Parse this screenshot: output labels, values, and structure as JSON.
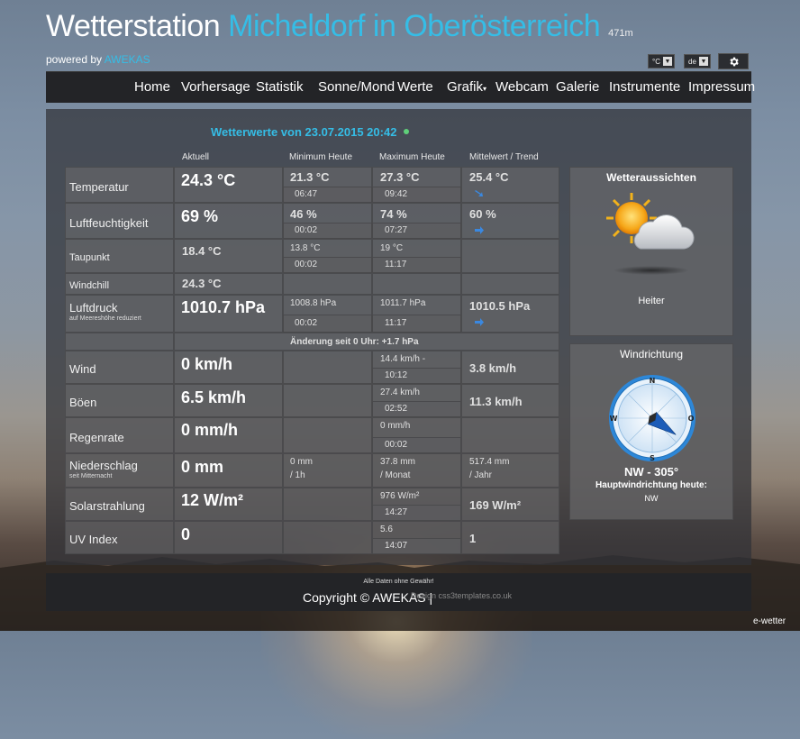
{
  "header": {
    "title_main": "Wetterstation",
    "title_location": "Micheldorf in Oberösterreich",
    "altitude": "471m",
    "powered_prefix": "powered by",
    "powered_link": "AWEKAS",
    "unit_select": "°C",
    "lang_select": "de"
  },
  "nav": [
    "Home",
    "Vorhersage",
    "Statistik",
    "Sonne/Mond",
    "Werte",
    "Grafik",
    "Webcam",
    "Galerie",
    "Instrumente",
    "Impressum"
  ],
  "weather": {
    "heading": "Wetterwerte von 23.07.2015 20:42",
    "columns": [
      "Aktuell",
      "Minimum Heute",
      "Maximum Heute",
      "Mittelwert / Trend"
    ],
    "rows": {
      "temperatur": {
        "label": "Temperatur",
        "current": "24.3 °C",
        "min": "21.3 °C",
        "min_time": "06:47",
        "max": "27.3 °C",
        "max_time": "09:42",
        "avg": "25.4 °C"
      },
      "feuchte": {
        "label": "Luftfeuchtigkeit",
        "current": "69 %",
        "min": "46 %",
        "min_time": "00:02",
        "max": "74 %",
        "max_time": "07:27",
        "avg": "60 %"
      },
      "taupunkt": {
        "label": "Taupunkt",
        "current": "18.4 °C",
        "min": "13.8 °C",
        "min_time": "00:02",
        "max": "19 °C",
        "max_time": "11:17"
      },
      "windchill": {
        "label": "Windchill",
        "current": "24.3 °C"
      },
      "luftdruck": {
        "label": "Luftdruck",
        "sublabel": "auf Meereshöhe reduziert",
        "current": "1010.7 hPa",
        "min": "1008.8 hPa",
        "min_time": "00:02",
        "max": "1011.7 hPa",
        "max_time": "11:17",
        "avg": "1010.5 hPa",
        "change": "Änderung seit 0 Uhr: +1.7 hPa"
      },
      "wind": {
        "label": "Wind",
        "current": "0 km/h",
        "max": "14.4 km/h -",
        "max_time": "10:12",
        "avg": "3.8 km/h"
      },
      "boeen": {
        "label": "Böen",
        "current": "6.5 km/h",
        "max": "27.4 km/h",
        "max_time": "02:52",
        "avg": "11.3 km/h"
      },
      "regenrate": {
        "label": "Regenrate",
        "current": "0 mm/h",
        "max": "0 mm/h",
        "max_time": "00:02"
      },
      "niederschlag": {
        "label": "Niederschlag",
        "sublabel": "seit Mitternacht",
        "current": "0 mm",
        "min": "0 mm",
        "min2": "/ 1h",
        "max": "37.8 mm",
        "max2": "/ Monat",
        "avg": "517.4 mm",
        "avg2": "/ Jahr"
      },
      "solar": {
        "label": "Solarstrahlung",
        "current": "12 W/m²",
        "max": "976 W/m²",
        "max_time": "14:27",
        "avg": "169 W/m²"
      },
      "uv": {
        "label": "UV Index",
        "current": "0",
        "max": "5.6",
        "max_time": "14:07",
        "avg": "1"
      }
    }
  },
  "forecast": {
    "title": "Wetteraussichten",
    "text": "Heiter"
  },
  "winddir": {
    "title": "Windrichtung",
    "value": "NW - 305°",
    "main_label": "Hauptwindrichtung heute:",
    "main_value": "NW",
    "direction_deg": 305,
    "compass": [
      "N",
      "O",
      "S",
      "W"
    ]
  },
  "footer": {
    "note": "Alle Daten ohne Gewähr!",
    "copyright": "Copyright © AWEKAS |",
    "design": "Design css3templates.co.uk"
  },
  "corner_badge": "e-wetter",
  "colors": {
    "accent": "#35bde6",
    "status_dot": "#5fd07a"
  }
}
